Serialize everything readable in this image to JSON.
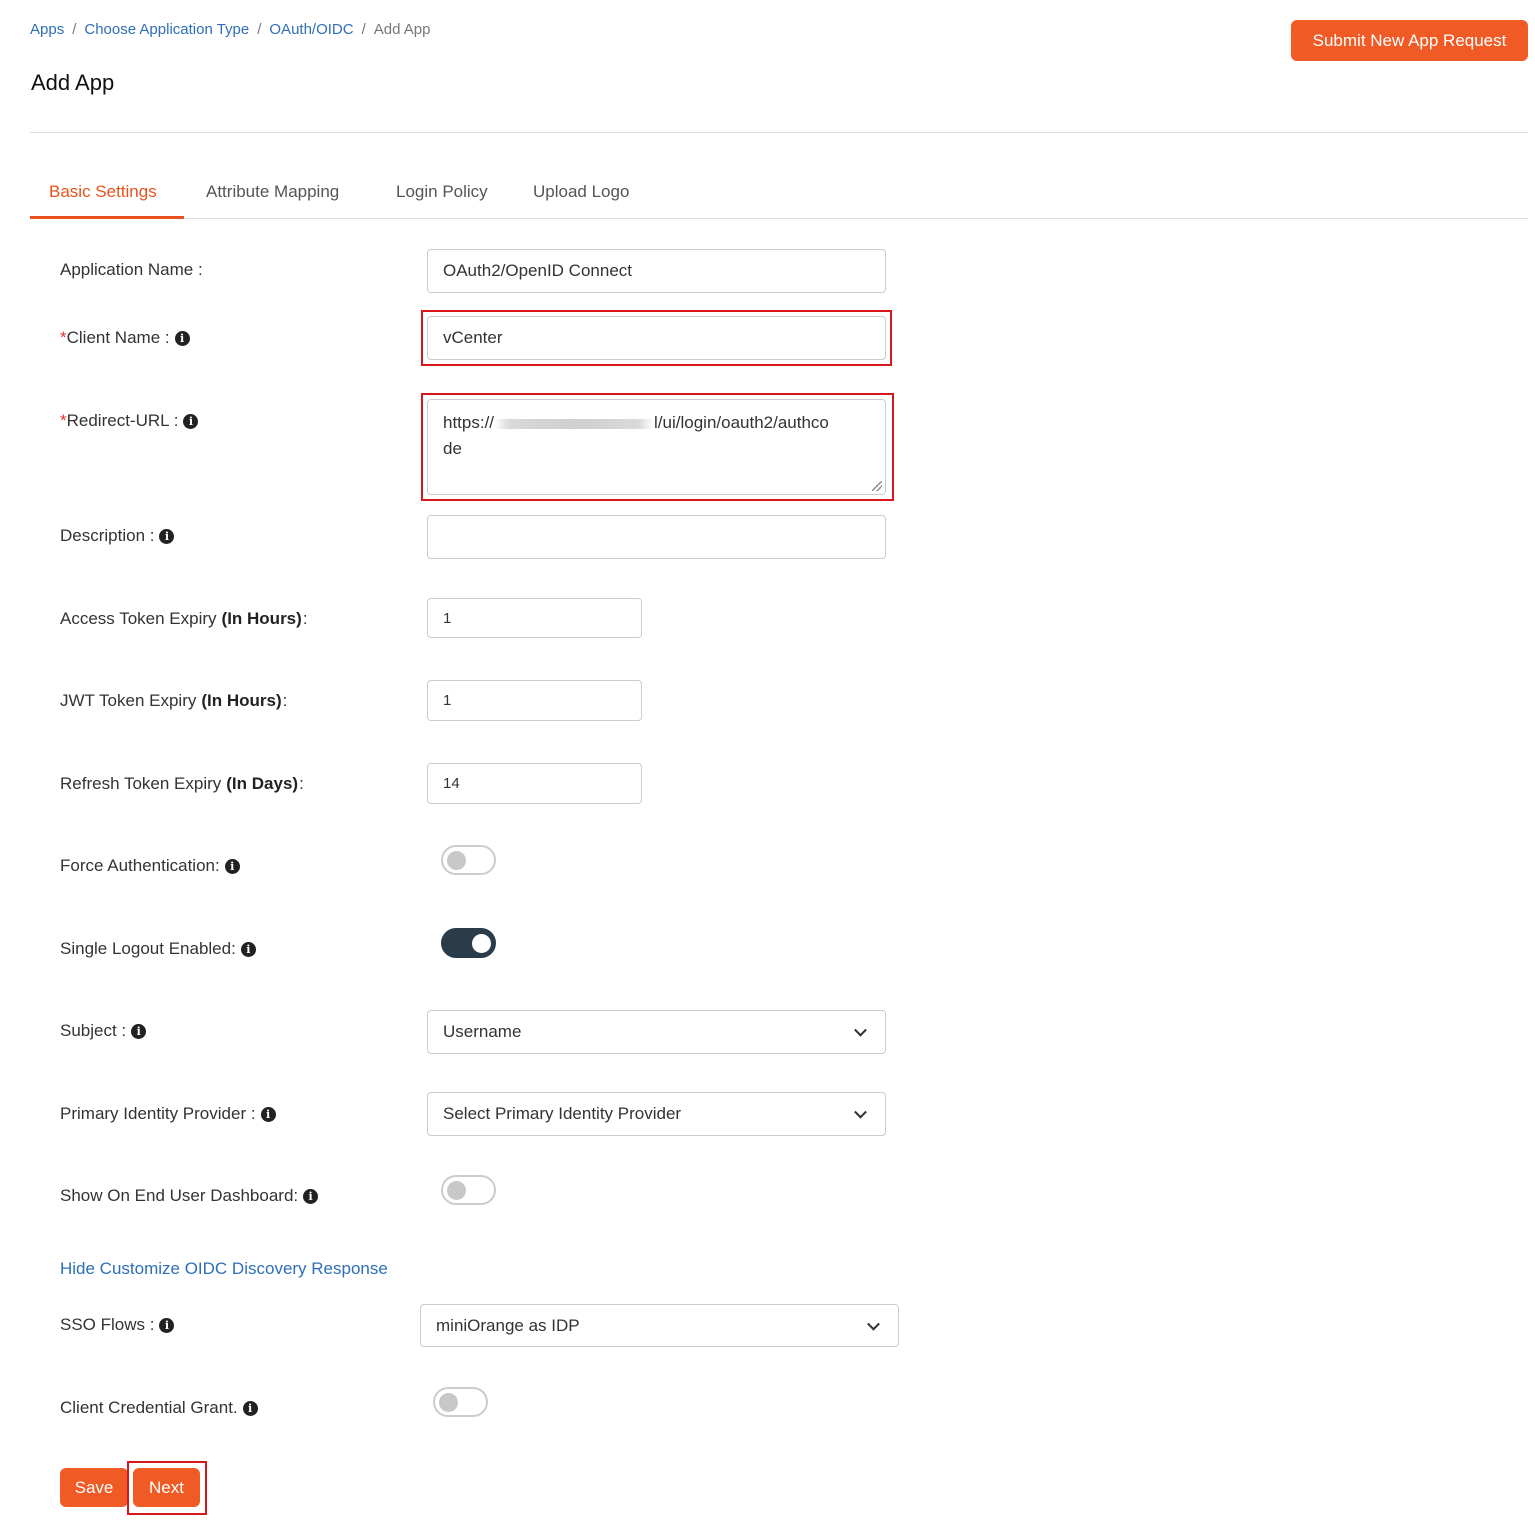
{
  "breadcrumb": {
    "items": [
      "Apps",
      "Choose Application Type",
      "OAuth/OIDC"
    ],
    "current": "Add App",
    "separator": "/"
  },
  "page": {
    "title": "Add App"
  },
  "header": {
    "submit_button": "Submit New App Request"
  },
  "tabs": [
    {
      "label": "Basic Settings",
      "active": true
    },
    {
      "label": "Attribute Mapping",
      "active": false
    },
    {
      "label": "Login Policy",
      "active": false
    },
    {
      "label": "Upload Logo",
      "active": false
    }
  ],
  "form": {
    "required_mark": "*",
    "info_glyph": "i",
    "application_name": {
      "label": "Application Name :",
      "value": "OAuth2/OpenID Connect"
    },
    "client_name": {
      "label": "Client Name :",
      "value": "vCenter",
      "required": true
    },
    "redirect_url": {
      "label": "Redirect-URL :",
      "value_prefix": "https://",
      "value_suffix": "l/ui/login/oauth2/authco",
      "value_wrap": "de",
      "required": true
    },
    "description": {
      "label": "Description :",
      "value": ""
    },
    "access_token_expiry": {
      "label": "Access Token Expiry",
      "unit": "(In Hours)",
      "colon": ":",
      "value": "1"
    },
    "jwt_token_expiry": {
      "label": "JWT Token Expiry",
      "unit": "(In Hours)",
      "colon": ":",
      "value": "1"
    },
    "refresh_token_expiry": {
      "label": "Refresh Token Expiry",
      "unit": "(In Days)",
      "colon": ":",
      "value": "14"
    },
    "force_authentication": {
      "label": "Force Authentication:",
      "enabled": false
    },
    "single_logout": {
      "label": "Single Logout Enabled:",
      "enabled": true
    },
    "subject": {
      "label": "Subject :",
      "selected": "Username"
    },
    "primary_idp": {
      "label": "Primary Identity Provider :",
      "selected": "Select Primary Identity Provider"
    },
    "show_on_dashboard": {
      "label": "Show On End User Dashboard:",
      "enabled": false
    },
    "oidc_discovery_link": "Hide Customize OIDC Discovery Response",
    "sso_flows": {
      "label": "SSO Flows :",
      "selected": "miniOrange as IDP"
    },
    "client_credential_grant": {
      "label": "Client Credential Grant.",
      "enabled": false
    }
  },
  "actions": {
    "save": "Save",
    "next": "Next"
  },
  "colors": {
    "accent": "#f05a24",
    "link": "#2e6fb7",
    "highlight": "#d9161c",
    "toggle_on": "#2a3b4a"
  },
  "icons": {
    "info": "info-circle-icon",
    "chevron": "chevron-down-icon"
  }
}
